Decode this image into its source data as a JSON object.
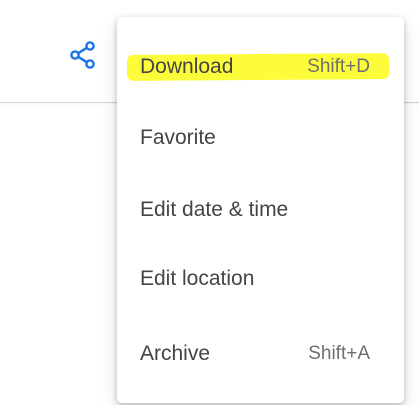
{
  "toolbar": {
    "share_icon": "share-icon",
    "share_icon_color": "#1a73e8"
  },
  "menu": {
    "items": [
      {
        "label": "Download",
        "shortcut": "Shift+D",
        "highlighted": true
      },
      {
        "label": "Favorite",
        "shortcut": ""
      },
      {
        "label": "Edit date & time",
        "shortcut": ""
      },
      {
        "label": "Edit location",
        "shortcut": ""
      },
      {
        "label": "Archive",
        "shortcut": "Shift+A"
      }
    ],
    "highlight_color": "#fdfc3b"
  }
}
